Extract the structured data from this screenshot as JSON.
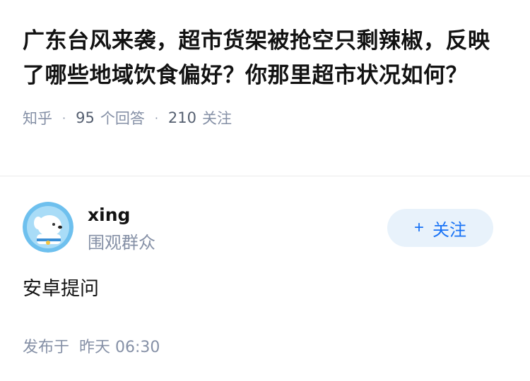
{
  "question": {
    "title": "广东台风来袭，超市货架被抢空只剩辣椒，反映了哪些地域饮食偏好？你那里超市状况如何？",
    "source": "知乎",
    "answer_count": "95",
    "answer_label": "个回答",
    "follow_count": "210",
    "follow_label": "关注"
  },
  "answer": {
    "author_name": "xing",
    "author_tag": "围观群众",
    "follow_button": "关注",
    "content": "安卓提问",
    "published_label": "发布于",
    "published_time": "昨天 06:30"
  },
  "colors": {
    "accent": "#1772f6",
    "meta": "#8590a6",
    "button_bg": "#e8f2fb"
  },
  "icons": {
    "follow": "plus-icon",
    "separator": "dot-separator"
  }
}
